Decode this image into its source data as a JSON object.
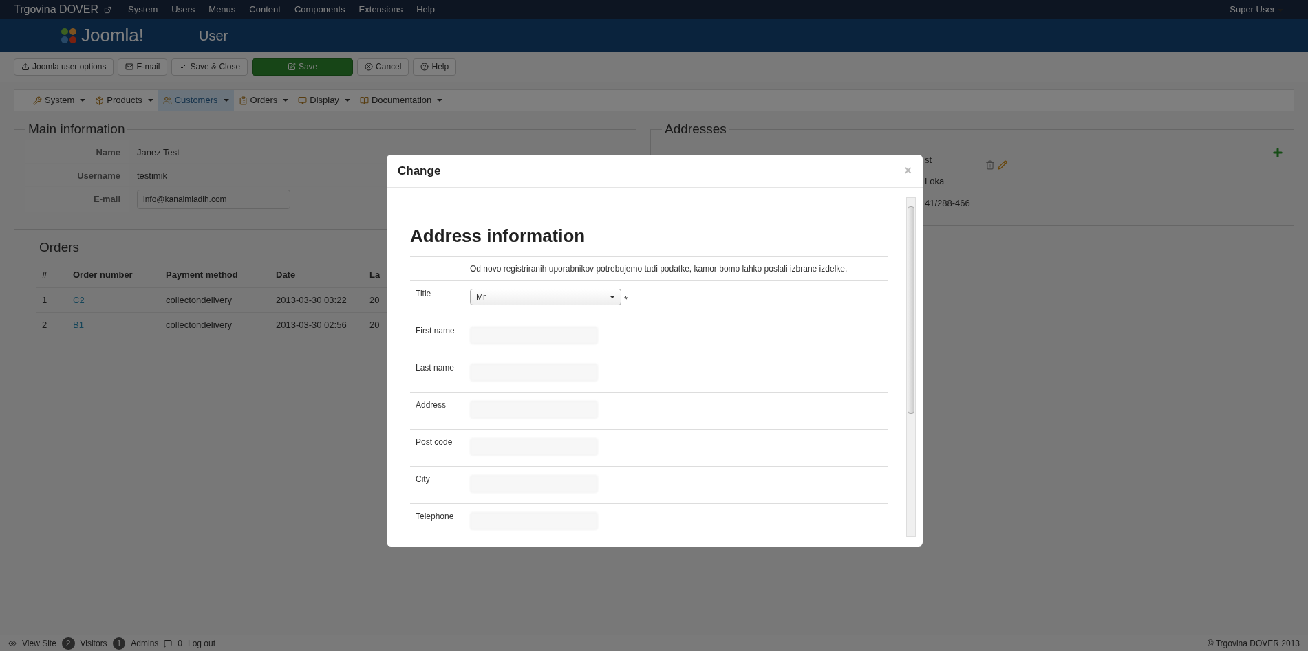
{
  "topbar": {
    "site_title": "Trgovina DOVER",
    "menu": [
      "System",
      "Users",
      "Menus",
      "Content",
      "Components",
      "Extensions",
      "Help"
    ],
    "user": "Super User"
  },
  "header": {
    "logo_text": "Joomla!",
    "title": "User"
  },
  "toolbar": [
    {
      "label": "Joomla user options",
      "kind": "default"
    },
    {
      "label": "E-mail",
      "kind": "default"
    },
    {
      "label": "Save & Close",
      "kind": "default"
    },
    {
      "label": "Save",
      "kind": "primary"
    },
    {
      "label": "Cancel",
      "kind": "default"
    },
    {
      "label": "Help",
      "kind": "default"
    }
  ],
  "submenu": [
    {
      "label": "System",
      "selected": false
    },
    {
      "label": "Products",
      "selected": false
    },
    {
      "label": "Customers",
      "selected": true
    },
    {
      "label": "Orders",
      "selected": false
    },
    {
      "label": "Display",
      "selected": false
    },
    {
      "label": "Documentation",
      "selected": false
    }
  ],
  "main_info": {
    "legend": "Main information",
    "fields": [
      {
        "label": "Name",
        "value": "Janez Test",
        "kind": "text"
      },
      {
        "label": "Username",
        "value": "testimik",
        "kind": "text"
      },
      {
        "label": "E-mail",
        "value": "info@kanalmladih.com",
        "kind": "input"
      }
    ]
  },
  "orders": {
    "legend": "Orders",
    "columns": [
      "#",
      "Order number",
      "Payment method",
      "Date",
      "La"
    ],
    "rows": [
      [
        "1",
        "C2",
        "collectondelivery",
        "2013-03-30 03:22",
        "20"
      ],
      [
        "2",
        "B1",
        "collectondelivery",
        "2013-03-30 02:56",
        "20"
      ]
    ]
  },
  "addresses": {
    "legend": "Addresses",
    "lines": [
      "st",
      "Loka",
      "41/288-466"
    ]
  },
  "modal": {
    "title": "Change",
    "close": "×",
    "heading": "Address information",
    "note": "Od novo registriranih uporabnikov potrebujemo tudi podatke, kamor bomo lahko poslali izbrane izdelke.",
    "fields": [
      {
        "label": "Title",
        "kind": "select",
        "value": "Mr",
        "mark": "*"
      },
      {
        "label": "First name",
        "kind": "input"
      },
      {
        "label": "Last name",
        "kind": "input"
      },
      {
        "label": "Address",
        "kind": "input"
      },
      {
        "label": "Post code",
        "kind": "input"
      },
      {
        "label": "City",
        "kind": "input"
      },
      {
        "label": "Telephone",
        "kind": "input"
      }
    ]
  },
  "footer": {
    "items": [
      {
        "label": "View Site"
      },
      {
        "count": "2",
        "label": "Visitors"
      },
      {
        "count": "1",
        "label": "Admins"
      },
      {
        "count": "0",
        "label": "Log out"
      }
    ],
    "copyright": "© Trgovina DOVER 2013"
  }
}
